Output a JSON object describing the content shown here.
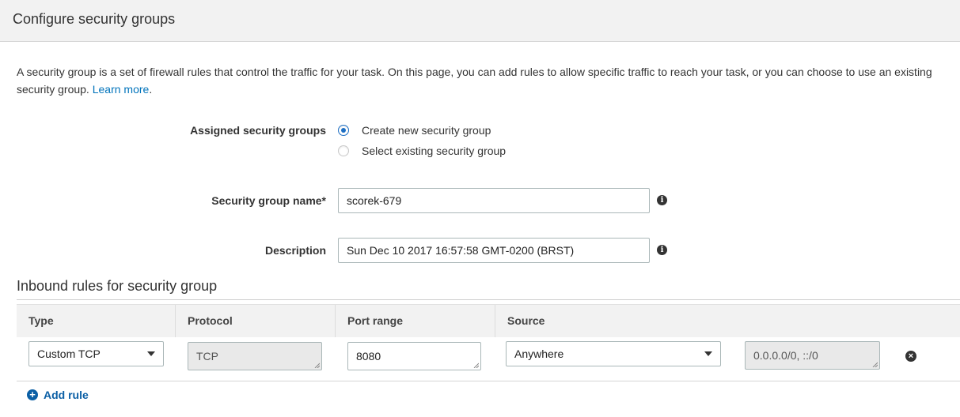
{
  "header": {
    "title": "Configure security groups"
  },
  "intro": {
    "text": "A security group is a set of firewall rules that control the traffic for your task. On this page, you can add rules to allow specific traffic to reach your task, or you can choose to use an existing security group.",
    "link": "Learn more",
    "trailing": "."
  },
  "assigned": {
    "label": "Assigned security groups",
    "options": [
      {
        "label": "Create new security group",
        "selected": true
      },
      {
        "label": "Select existing security group",
        "selected": false
      }
    ]
  },
  "name_field": {
    "label": "Security group name*",
    "value": "scorek-679",
    "info_icon": "info-icon"
  },
  "description_field": {
    "label": "Description",
    "value": "Sun Dec 10 2017 16:57:58 GMT-0200 (BRST)",
    "info_icon": "info-icon"
  },
  "inbound": {
    "title": "Inbound rules for security group",
    "columns": [
      "Type",
      "Protocol",
      "Port range",
      "Source"
    ],
    "rows": [
      {
        "type": "Custom TCP",
        "protocol": "TCP",
        "port_range": "8080",
        "source": "Anywhere",
        "cidr": "0.0.0.0/0, ::/0"
      }
    ],
    "add_rule_label": "Add rule"
  },
  "colors": {
    "accent": "#0073bb",
    "radio": "#1d6fc4",
    "header_bg": "#f2f2f2"
  }
}
